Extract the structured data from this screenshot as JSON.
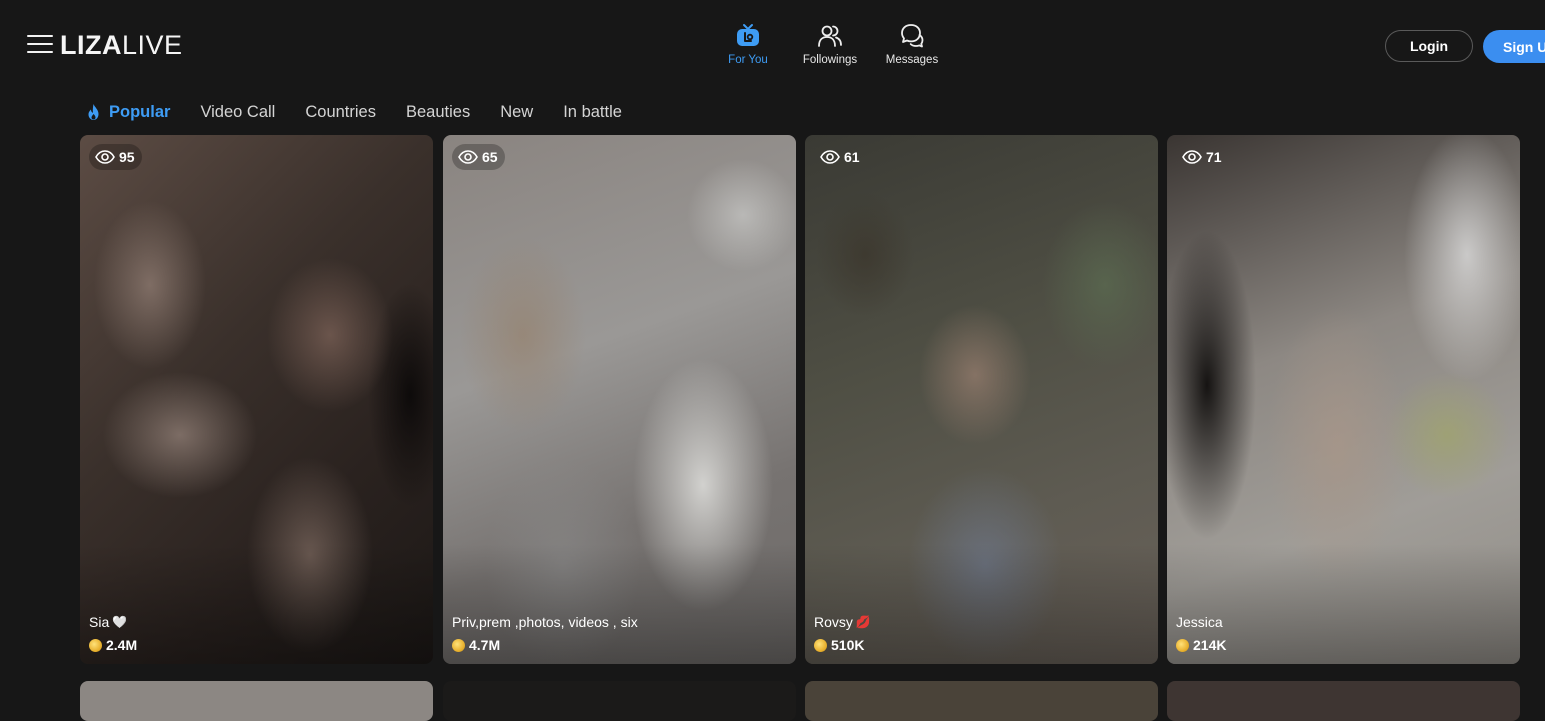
{
  "header": {
    "logo_bold": "LIZA",
    "logo_light": "LIVE",
    "nav": [
      {
        "label": "For You",
        "icon": "tv-icon",
        "active": true
      },
      {
        "label": "Followings",
        "icon": "users-icon",
        "active": false
      },
      {
        "label": "Messages",
        "icon": "chat-bubbles-icon",
        "active": false
      }
    ],
    "login_label": "Login",
    "signup_label": "Sign Up"
  },
  "tabs": [
    {
      "label": "Popular",
      "icon": "flame-icon",
      "active": true
    },
    {
      "label": "Video Call",
      "active": false
    },
    {
      "label": "Countries",
      "active": false
    },
    {
      "label": "Beauties",
      "active": false
    },
    {
      "label": "New",
      "active": false
    },
    {
      "label": "In battle",
      "active": false
    }
  ],
  "cards": [
    {
      "viewers": "95",
      "name": "Sia",
      "emoji": "🤍",
      "coins": "2.4M"
    },
    {
      "viewers": "65",
      "name": "Priv,prem ,photos, videos , six",
      "emoji": "",
      "coins": "4.7M"
    },
    {
      "viewers": "61",
      "name": "Rovsy",
      "emoji": "💋",
      "coins": "510K"
    },
    {
      "viewers": "71",
      "name": "Jessica",
      "emoji": "",
      "coins": "214K"
    }
  ],
  "colors": {
    "accent": "#3e9cf4",
    "signup": "#3b8ef0",
    "background": "#171717",
    "coin": "#e9b230"
  }
}
